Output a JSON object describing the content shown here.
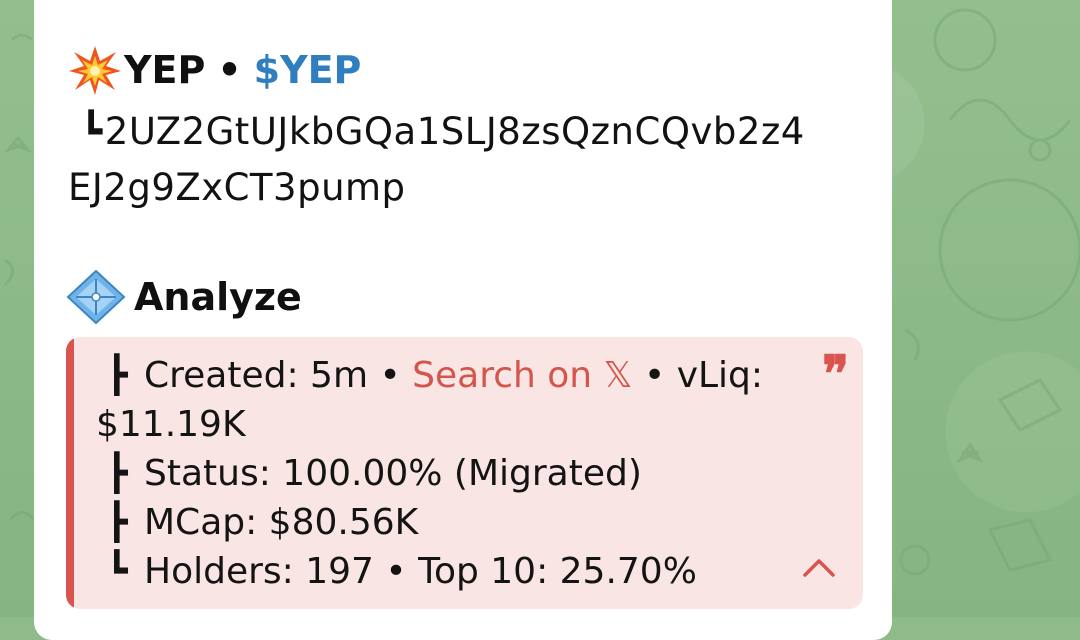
{
  "header": {
    "icon": "collision-emoji-icon",
    "name": "YEP",
    "separator": "•",
    "ticker": "$YEP"
  },
  "address": {
    "tree_glyph": "┗",
    "line1": "2UZ2GtUJkbGQa1SLJ8zsQznCQvb2z4",
    "line2": "EJ2g9ZxCT3pump"
  },
  "analyze": {
    "icon": "diamond-with-dot-emoji-icon",
    "title": "Analyze"
  },
  "details": {
    "created_tree": "┣",
    "created_label": "Created: 5m",
    "bullet1": " • ",
    "search_link": "Search on 𝕏",
    "bullet2": " • ",
    "vliq_label": "vLiq:",
    "vliq_value": "$11.19K",
    "status_tree": "┣",
    "status": "Status: 100.00% (Migrated)",
    "mcap_tree": "┣",
    "mcap": "MCap: $80.56K",
    "holders_tree": "┗",
    "holders": "Holders: 197",
    "bullet3": " • ",
    "top10": "Top 10: 25.70%",
    "quote_glyph": "❞",
    "accent_color": "#d9534f",
    "link_color": "#d4554c",
    "quote_bg": "#f9e6e4"
  },
  "colors": {
    "ticker": "#2f7fc0",
    "wallpaper": "#8fbb8a",
    "bubble": "#ffffff"
  }
}
